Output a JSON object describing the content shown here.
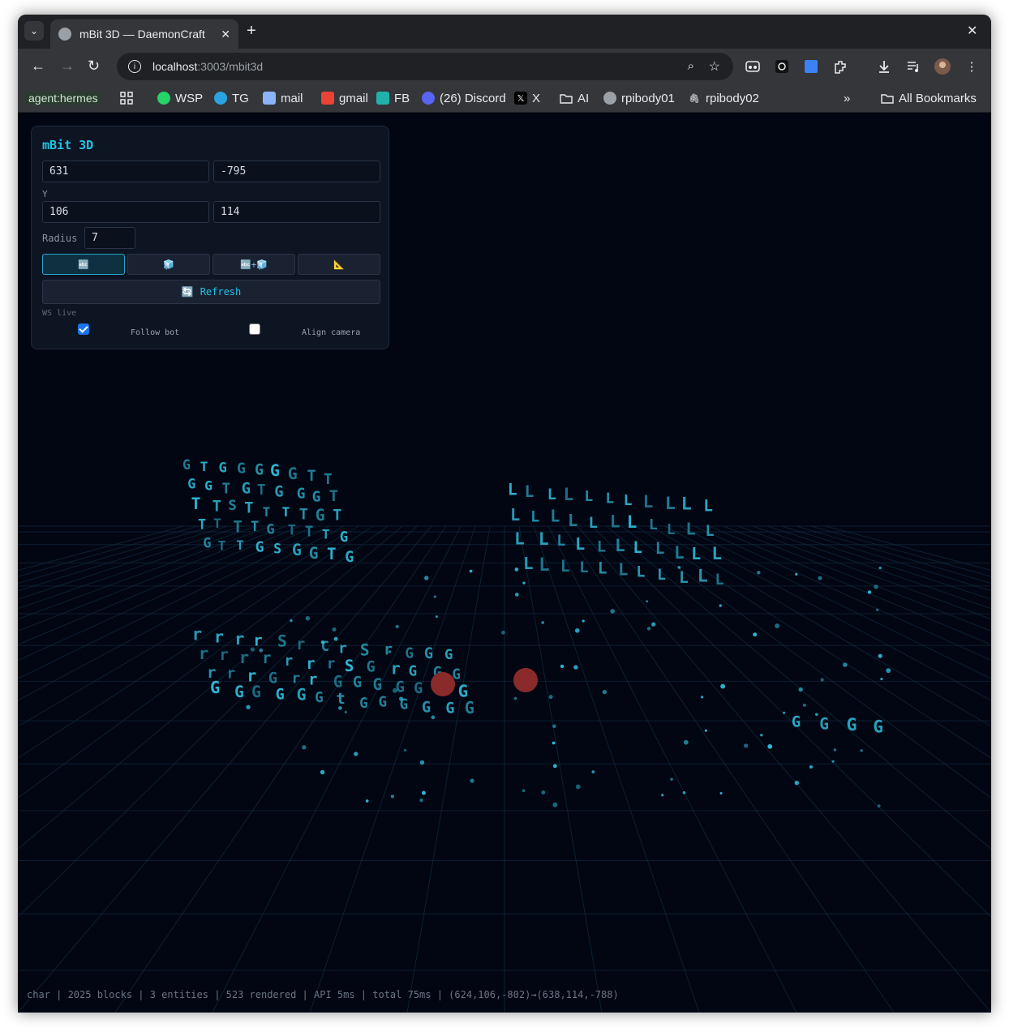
{
  "browser": {
    "tab_title": "mBit 3D — DaemonCraft",
    "url_host": "localhost",
    "url_path": ":3003/mbit3d",
    "new_tab_label": "+",
    "close_label": "✕",
    "profile_label": "agent:hermes",
    "bookmarks": [
      {
        "label": "WSP",
        "icon": "whatsapp-icon",
        "color": "#25d366"
      },
      {
        "label": "TG",
        "icon": "telegram-icon",
        "color": "#2aa3e0"
      },
      {
        "label": "mail",
        "icon": "mail-icon",
        "color": "#8ab4f8"
      },
      {
        "label": "gmail",
        "icon": "gmail-icon",
        "color": "#ea4335"
      },
      {
        "label": "FB",
        "icon": "fb-icon",
        "color": "#20b2aa"
      },
      {
        "label": "(26) Discord",
        "icon": "discord-icon",
        "color": "#5865f2"
      },
      {
        "label": "X",
        "icon": "x-icon",
        "color": "#000000"
      },
      {
        "label": "AI",
        "icon": "folder-icon",
        "color": "#35363a"
      },
      {
        "label": "rpibody01",
        "icon": "globe-icon",
        "color": "#9aa0a6"
      },
      {
        "label": "rpibody02",
        "icon": "paperclip-icon",
        "color": "#35363a"
      }
    ],
    "all_bookmarks": "All Bookmarks",
    "overflow": "»"
  },
  "panel": {
    "title": "mBit 3D",
    "x_value": "631",
    "z_value": "-795",
    "y_label": "Y",
    "y_min": "106",
    "y_max": "114",
    "radius_label": "Radius",
    "radius_value": "7",
    "modes": [
      {
        "label": "🔤",
        "icon": "text-mode-icon",
        "active": true
      },
      {
        "label": "🧊",
        "icon": "block-mode-icon",
        "active": false
      },
      {
        "label": "🔤+🧊",
        "icon": "mixed-mode-icon",
        "active": false
      },
      {
        "label": "📐",
        "icon": "measure-mode-icon",
        "active": false
      }
    ],
    "refresh_icon": "🔄",
    "refresh_label": "Refresh",
    "ws_status": "WS live",
    "follow_bot_label": "Follow bot",
    "follow_bot_checked": true,
    "align_camera_label": "Align camera",
    "align_camera_checked": false
  },
  "status_bar": "char | 2025 blocks | 3 entities | 523 rendered | API 5ms | total 75ms | (624,106,-802)→(638,114,-788)",
  "scene_glyphs": {
    "left_cluster": [
      "G",
      "T",
      "G",
      "G",
      "G",
      "G",
      "G",
      "T",
      "T",
      "G",
      "G",
      "T",
      "G",
      "T",
      "G",
      "G",
      "G",
      "T",
      "T",
      "T",
      "S",
      "T",
      "T",
      "T",
      "T",
      "G",
      "T",
      "T",
      "T",
      "T",
      "T",
      "G",
      "T",
      "T",
      "T",
      "G",
      "G",
      "T",
      "T",
      "G",
      "S",
      "G",
      "G",
      "T",
      "G"
    ],
    "front_rows": [
      "r",
      "r",
      "r",
      "r",
      "S",
      "r",
      "C",
      "r",
      "S",
      "r",
      "G",
      "G",
      "G",
      "r",
      "r",
      "r",
      "r",
      "r",
      "r",
      "r",
      "S",
      "G",
      "r",
      "G",
      "G",
      "G",
      "r",
      "r",
      "r",
      "G",
      "r",
      "r",
      "G",
      "G",
      "G",
      "G",
      "G",
      "G",
      "G",
      "G",
      "G",
      "G",
      "G",
      "G",
      "G",
      "t",
      "G",
      "G",
      "G",
      "G",
      "G",
      "G"
    ],
    "right_cluster": [
      "L",
      "L",
      "L",
      "L",
      "L",
      "L",
      "L",
      "L",
      "L",
      "L",
      "L",
      "L",
      "L",
      "L",
      "L",
      "L",
      "L",
      "L",
      "L",
      "L",
      "L",
      "L",
      "L",
      "L",
      "L",
      "L",
      "L",
      "L",
      "L",
      "L",
      "L",
      "L",
      "L",
      "L",
      "L",
      "L",
      "L",
      "L",
      "L",
      "L",
      "L",
      "L",
      "L",
      "L"
    ],
    "right_g_row": [
      "G",
      "G",
      "G",
      "G"
    ]
  },
  "colors": {
    "glyph": "#2fb8d6",
    "glyph_dim": "#1c6f86",
    "grid": "#12324a",
    "entity": "#8a2a2a",
    "background": "#020612"
  }
}
